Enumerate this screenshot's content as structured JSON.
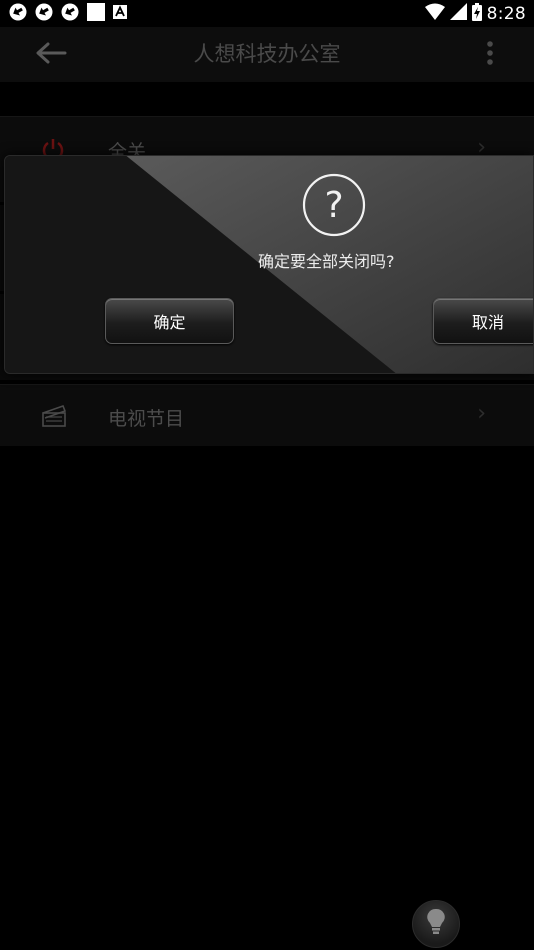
{
  "status_bar": {
    "time": "8:28",
    "icons": [
      "sync-icon",
      "sync-icon",
      "sync-icon",
      "square-notification-icon",
      "a-notification-icon",
      "wifi-icon",
      "cell-signal-icon",
      "battery-icon"
    ]
  },
  "app_bar": {
    "title": "人想科技办公室",
    "back_icon": "arrow-left-icon",
    "menu_icon": "more-vert-icon"
  },
  "list": {
    "items": [
      {
        "label": "全关",
        "icon": "power-icon"
      },
      {
        "label": "电视节目",
        "icon": "clapperboard-icon"
      }
    ]
  },
  "dialog": {
    "icon": "question-icon",
    "message": "确定要全部关闭吗?",
    "confirm_label": "确定",
    "cancel_label": "取消"
  },
  "fab": {
    "icon": "lightbulb-icon"
  },
  "colors": {
    "background": "#000000",
    "app_bar": "#0d0d0d",
    "title_text": "#4a4a4a",
    "power_icon": "#7a1414"
  }
}
